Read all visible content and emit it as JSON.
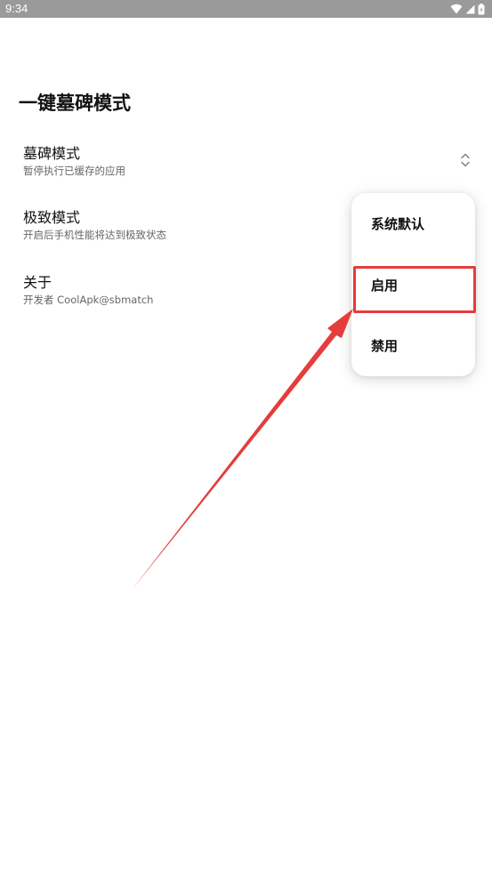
{
  "status_bar": {
    "time": "9:34",
    "icons": [
      "wifi-icon",
      "signal-icon",
      "battery-icon"
    ]
  },
  "page": {
    "title": "一键墓碑模式"
  },
  "settings": [
    {
      "title": "墓碑模式",
      "summary": "暂停执行已缓存的应用",
      "has_spinner": true,
      "spinner_icon": "chevron-up-down-icon"
    },
    {
      "title": "极致模式",
      "summary": "开启后手机性能将达到极致状态"
    },
    {
      "title": "关于",
      "summary": "开发者 CoolApk@sbmatch"
    }
  ],
  "popup_menu": {
    "items": [
      {
        "label": "系统默认"
      },
      {
        "label": "启用"
      },
      {
        "label": "禁用"
      }
    ],
    "highlighted_index": 1
  },
  "annotation": {
    "color": "#e53c3c",
    "arrow_icon": "arrow-annotation-icon"
  },
  "colors": {
    "status_bar": "#9a9a9a",
    "background": "#ffffff",
    "summary_text": "#666666"
  }
}
